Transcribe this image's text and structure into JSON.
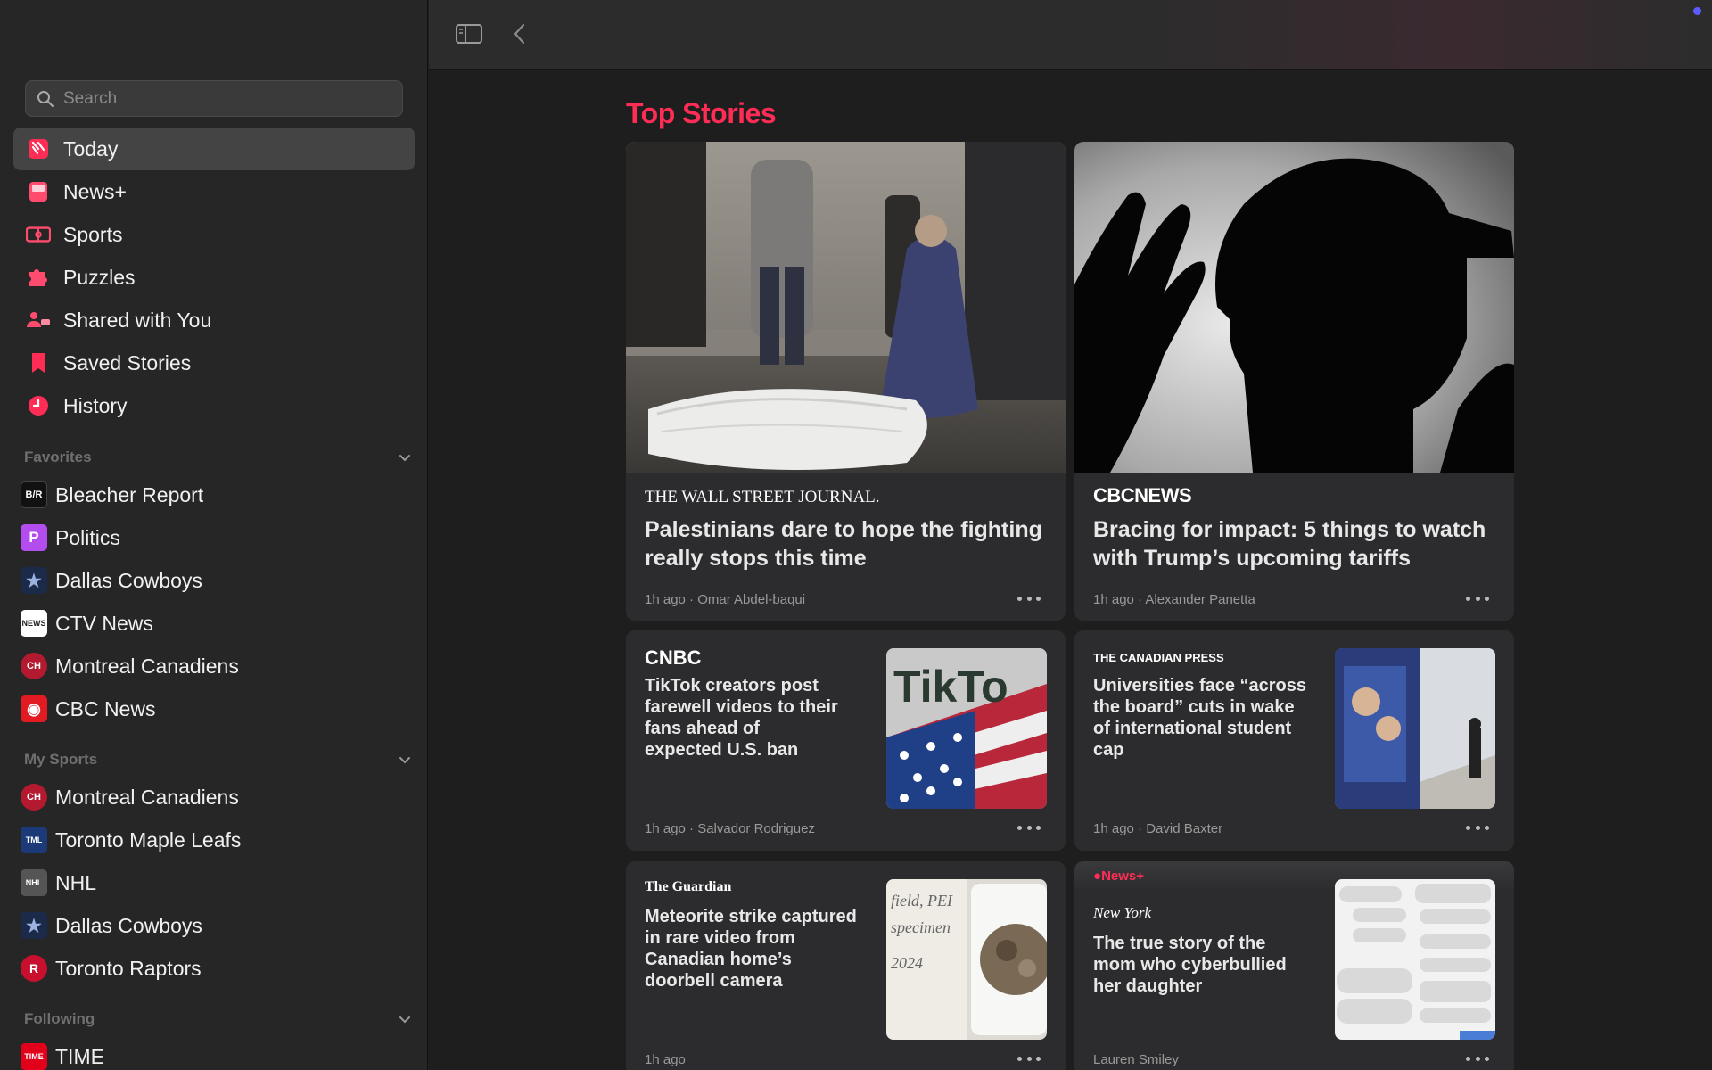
{
  "search": {
    "placeholder": "Search"
  },
  "nav": [
    {
      "label": "Today",
      "icon": "today-icon"
    },
    {
      "label": "News+",
      "icon": "newsplus-icon"
    },
    {
      "label": "Sports",
      "icon": "sports-icon"
    },
    {
      "label": "Puzzles",
      "icon": "puzzle-icon"
    },
    {
      "label": "Shared with You",
      "icon": "shared-icon"
    },
    {
      "label": "Saved Stories",
      "icon": "bookmark-icon"
    },
    {
      "label": "History",
      "icon": "history-icon"
    }
  ],
  "favorites": {
    "title": "Favorites",
    "items": [
      {
        "label": "Bleacher Report",
        "badge": "B/R",
        "color": "#111111"
      },
      {
        "label": "Politics",
        "badge": "P",
        "color": "#b44df0"
      },
      {
        "label": "Dallas Cowboys",
        "badge": "★",
        "color": "#1c2a4a"
      },
      {
        "label": "CTV News",
        "badge": "NEWS",
        "color": "#ffffff"
      },
      {
        "label": "Montreal Canadiens",
        "badge": "CH",
        "color": "#b3192f"
      },
      {
        "label": "CBC News",
        "badge": "◉",
        "color": "#e21b23"
      }
    ]
  },
  "my_sports": {
    "title": "My Sports",
    "items": [
      {
        "label": "Montreal Canadiens",
        "badge": "CH",
        "color": "#b3192f"
      },
      {
        "label": "Toronto Maple Leafs",
        "badge": "TML",
        "color": "#1d3a78"
      },
      {
        "label": "NHL",
        "badge": "NHL",
        "color": "#555555"
      },
      {
        "label": "Dallas Cowboys",
        "badge": "★",
        "color": "#1c2a4a"
      },
      {
        "label": "Toronto Raptors",
        "badge": "R",
        "color": "#c8102e"
      }
    ]
  },
  "following": {
    "title": "Following",
    "items": [
      {
        "label": "TIME",
        "badge": "TIME",
        "color": "#e3001b"
      }
    ]
  },
  "main": {
    "title": "Top Stories",
    "accent": "#ff2d55",
    "stories": [
      {
        "publisher": "THE WALL STREET JOURNAL.",
        "headline": "Palestinians dare to hope the fighting really stops this time",
        "meta": "1h ago · Omar Abdel-baqui"
      },
      {
        "publisher": "CBCNEWS",
        "headline": "Bracing for impact: 5 things to watch with Trump’s upcoming tariffs",
        "meta": "1h ago · Alexander Panetta"
      },
      {
        "publisher": "CNBC",
        "headline": "TikTok creators post farewell videos to their fans ahead of expected U.S. ban",
        "meta": "1h ago · Salvador Rodriguez"
      },
      {
        "publisher": "THE CANADIAN PRESS",
        "headline": "Universities face “across the board” cuts in wake of international student cap",
        "meta": "1h ago · David Baxter"
      },
      {
        "publisher": "The Guardian",
        "headline": "Meteorite strike captured in rare video from Canadian home’s doorbell camera",
        "meta": "1h ago"
      },
      {
        "badge": "News+",
        "publisher": "New York",
        "headline": "The true story of the mom who cyberbullied her daughter",
        "meta": "Lauren Smiley"
      }
    ]
  }
}
